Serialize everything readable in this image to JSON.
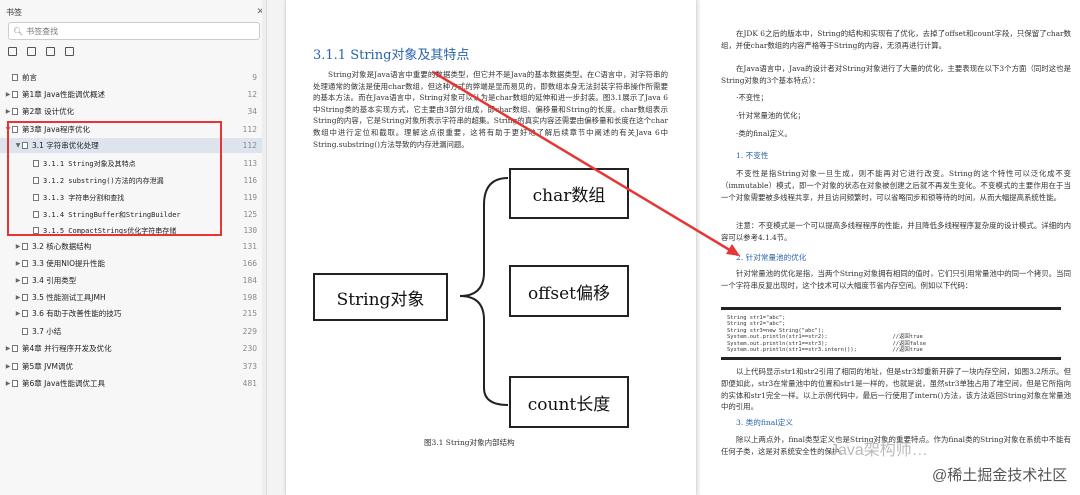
{
  "sidebar": {
    "title": "书签",
    "search_placeholder": "书签查找",
    "items": [
      {
        "label": "前言",
        "page": "9"
      },
      {
        "label": "第1章 Java性能调优概述",
        "page": "12"
      },
      {
        "label": "第2章 设计优化",
        "page": "34"
      },
      {
        "label": "第3章 Java程序优化",
        "page": "112"
      },
      {
        "label": "3.1 字符串优化处理",
        "page": "112"
      },
      {
        "label": "3.1.1 String对象及其特点",
        "page": "113"
      },
      {
        "label": "3.1.2 substring()方法的内存泄漏",
        "page": "116"
      },
      {
        "label": "3.1.3 字符串分割和查找",
        "page": "119"
      },
      {
        "label": "3.1.4 StringBuffer和StringBuilder",
        "page": "125"
      },
      {
        "label": "3.1.5 CompactStrings优化字符串存储",
        "page": "130"
      },
      {
        "label": "3.2 核心数据结构",
        "page": "131"
      },
      {
        "label": "3.3 使用NIO提升性能",
        "page": "166"
      },
      {
        "label": "3.4 引用类型",
        "page": "184"
      },
      {
        "label": "3.5 性能测试工具JMH",
        "page": "198"
      },
      {
        "label": "3.6 有助于改善性能的技巧",
        "page": "215"
      },
      {
        "label": "3.7 小结",
        "page": "229"
      },
      {
        "label": "第4章 并行程序开发及优化",
        "page": "230"
      },
      {
        "label": "第5章 JVM调优",
        "page": "373"
      },
      {
        "label": "第6章 Java性能调优工具",
        "page": "481"
      }
    ]
  },
  "page1": {
    "section_title": "3.1.1 String对象及其特点",
    "paragraph": "String对象是Java语言中重要的数据类型，但它并不是Java的基本数据类型。在C语言中，对字符串的处理通常的做法是使用char数组，但这种方式的弊端是显而易见的，即数组本身无法封装字符串操作所需要的基本方法。而在Java语言中，String对象可以认为是char数组的延伸和进一步封装。图3.1展示了Java 6中String类的基本实现方式，它主要由3部分组成，即char数组、偏移量和String的长度。char数组表示String的内容，它是String对象所表示字符串的超集。String的真实内容还需要由偏移量和长度在这个char数组中进行定位和截取。理解这点很重要，这将有助于更好地了解后续章节中阐述的有关Java 6中String.substring()方法导致的内存泄漏问题。",
    "diagram": {
      "main": "String对象",
      "parts": [
        "char数组",
        "offset偏移",
        "count长度"
      ]
    },
    "caption": "图3.1   String对象内部结构"
  },
  "page2": {
    "para1": "在JDK 6之后的版本中，String的结构和实现有了优化，去掉了offset和count字段，只保留了char数组，并使char数组的内容严格等于String的内容，无须再进行计算。",
    "para2": "在Java语言中，Java的设计者对String对象进行了大量的优化，主要表现在以下3个方面（同时这也是String对象的3个基本特点）：",
    "bullets": [
      "·不变性；",
      "·针对常量池的优化；",
      "·类的final定义。"
    ],
    "h1": "1. 不变性",
    "para3": "不变性是指String对象一旦生成，则不能再对它进行改变。String的这个特性可以泛化成不变（immutable）模式，即一个对象的状态在对象被创建之后就不再发生变化。不变模式的主要作用在于当一个对象需要被多线程共享，并且访问频繁时，可以省略同步和锁等待的时间，从而大幅提高系统性能。",
    "note": "注意：不变模式是一个可以提高多线程程序的性能，并且降低多线程程序复杂度的设计模式。详细的内容可以参考4.1.4节。",
    "h2": "2. 针对常量池的优化",
    "para4": "针对常量池的优化是指，当两个String对象拥有相同的值时，它们只引用常量池中的同一个拷贝。当同一个字符串反复出现时，这个技术可以大幅度节省内存空间。例如以下代码：",
    "code": "String str1=\"abc\";\nString str2=\"abc\";\nString str3=new String(\"abc\");\nSystem.out.println(str1==str2);                    //返回true\nSystem.out.println(str1==str3);                    //返回false\nSystem.out.println(str1==str3.intern());           //返回true",
    "para5": "以上代码显示str1和str2引用了相同的地址，但是str3却重新开辟了一块内存空间，如图3.2所示。但即便如此，str3在常量池中的位置和str1是一样的，也就是说，虽然str3单独占用了堆空间，但是它所指向的实体和str1完全一样。以上示例代码中，最后一行使用了intern()方法，该方法返回String对象在常量池中的引用。",
    "h3": "3. 类的final定义",
    "para6": "除以上两点外，final类型定义也是String对象的重要特点。作为final类的String对象在系统中不能有任何子类，这是对系统安全性的保护。",
    "watermark1": "Java架构师…",
    "watermark2": "@稀土掘金技术社区"
  },
  "colors": {
    "accent_blue": "#2a64a8",
    "highlight_red": "#e53535"
  }
}
